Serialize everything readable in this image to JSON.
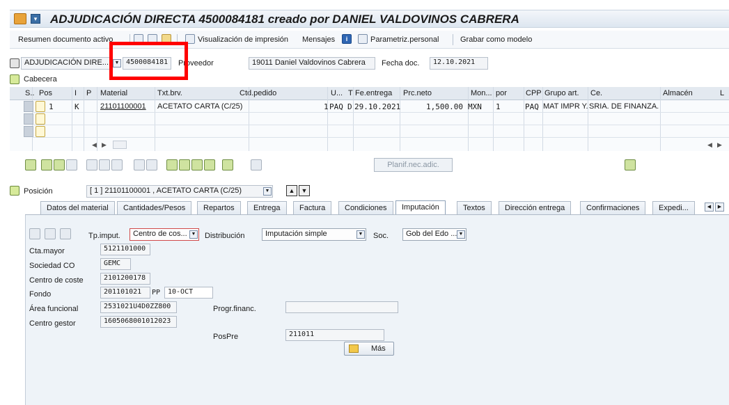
{
  "window": {
    "title": "ADJUDICACIÓN DIRECTA 4500084181 creado por DANIEL VALDOVINOS CABRERA"
  },
  "toolbar": {
    "resumen": "Resumen documento activo",
    "visualizacion": "Visualización de impresión",
    "mensajes": "Mensajes",
    "parametriz": "Parametriz.personal",
    "grabar": "Grabar como modelo"
  },
  "header": {
    "doc_type": "ADJUDICACIÓN DIRE...",
    "doc_number": "4500084181",
    "proveedor_label": "Proveedor",
    "proveedor_value": "19011 Daniel Valdovinos Cabrera",
    "fecha_label": "Fecha doc.",
    "fecha_value": "12.10.2021"
  },
  "cabecera_label": "Cabecera",
  "grid": {
    "headers": [
      "S..",
      "Pos",
      "I",
      "P",
      "Material",
      "Txt.brv.",
      "Ctd.pedido",
      "U...",
      "T",
      "Fe.entrega",
      "Prc.neto",
      "Mon...",
      "por",
      "CPP",
      "Grupo art.",
      "Ce.",
      "Almacén",
      "L"
    ],
    "row": {
      "pos": "1",
      "i": "K",
      "material": "21101100001",
      "txt": "ACETATO CARTA (C/25)",
      "qty": "1",
      "unit": "PAQ",
      "t": "D",
      "fecha": "29.10.2021",
      "precio": "1,500.00",
      "moneda": "MXN",
      "por": "1",
      "cpp": "PAQ",
      "grupo": "MAT IMPR Y...",
      "centro": "SRIA. DE FINANZA..."
    }
  },
  "planif_button": "Planif.nec.adic.",
  "posicion": {
    "label": "Posición",
    "value": "[ 1 ] 21101100001 , ACETATO CARTA (C/25)"
  },
  "tabs": [
    "Datos del material",
    "Cantidades/Pesos",
    "Repartos",
    "Entrega",
    "Factura",
    "Condiciones",
    "Imputación",
    "Textos",
    "Dirección entrega",
    "Confirmaciones",
    "Expedi..."
  ],
  "imputacion": {
    "tp_label": "Tp.imput.",
    "tp_value": "Centro de cos...",
    "distrib_label": "Distribución",
    "distrib_value": "Imputación simple",
    "soc_label": "Soc.",
    "soc_value": "Gob del Edo ...",
    "fields": [
      {
        "label": "Cta.mayor",
        "value": "5121101000"
      },
      {
        "label": "Sociedad CO",
        "value": "GEMC"
      },
      {
        "label": "Centro de coste",
        "value": "2101200178"
      },
      {
        "label": "Fondo",
        "value": "201101021"
      },
      {
        "label": "Área funcional",
        "value": "2531021U4D0ZZ800"
      },
      {
        "label": "Centro gestor",
        "value": "1605068001012023"
      }
    ],
    "pp_label": "PP",
    "pp_value": "10-OCT",
    "progr_label": "Progr.financ.",
    "progr_value": "",
    "pospre_label": "PosPre",
    "pospre_value": "211011",
    "mas_label": "Más"
  }
}
